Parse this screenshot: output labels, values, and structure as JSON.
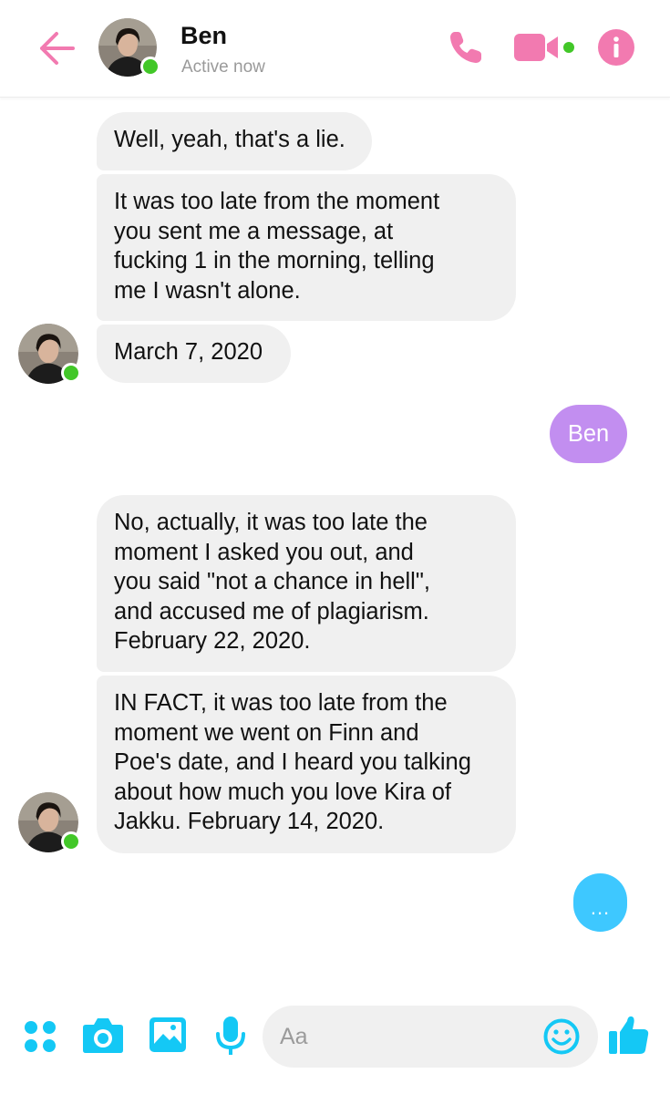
{
  "header": {
    "title": "Ben",
    "status": "Active now",
    "icons": [
      "back-arrow-icon",
      "phone-icon",
      "video-camera-icon",
      "info-icon"
    ],
    "accent_color": "#f27ab0",
    "presence_color": "#42c728"
  },
  "messages": [
    {
      "from": "Ben",
      "text": "Well, yeah, that's a lie."
    },
    {
      "from": "Ben",
      "text": "It was too late from the moment\nyou sent me a message, at\nfucking 1 in the morning, telling\nme I wasn't alone."
    },
    {
      "from": "Ben",
      "text": "March 7, 2020"
    },
    {
      "from": "me",
      "text": "Ben"
    },
    {
      "from": "Ben",
      "text": "No, actually, it was too late the\nmoment I asked you out, and\nyou said \"not a chance in hell\",\nand accused me of plagiarism.\nFebruary 22, 2020."
    },
    {
      "from": "Ben",
      "text": "IN FACT, it was too late from the\nmoment we went on Finn and\nPoe's date, and I heard you talking\nabout how much you love Kira of\nJakku. February 14, 2020."
    },
    {
      "from": "me",
      "text": "..."
    }
  ],
  "colors": {
    "received_bubble": "#f0f0f0",
    "sent_bubble": "#c28ef0",
    "pending_bubble": "#3ec8ff",
    "composer_icons": "#14c8f5"
  },
  "composer": {
    "placeholder": "Aa",
    "icons": [
      "apps-icon",
      "camera-icon",
      "gallery-icon",
      "microphone-icon",
      "emoji-icon",
      "thumbs-up-icon"
    ]
  }
}
